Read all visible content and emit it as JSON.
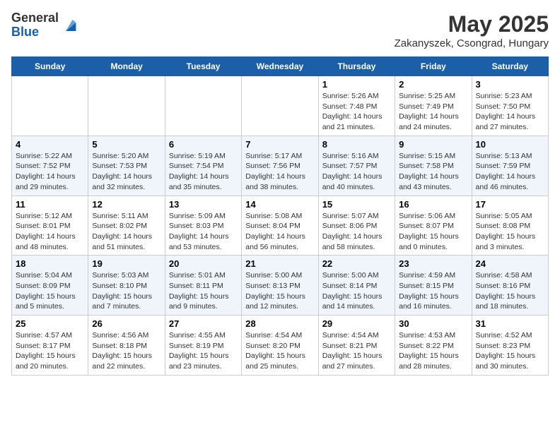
{
  "header": {
    "logo_line1": "General",
    "logo_line2": "Blue",
    "title": "May 2025",
    "subtitle": "Zakanyszek, Csongrad, Hungary"
  },
  "days_of_week": [
    "Sunday",
    "Monday",
    "Tuesday",
    "Wednesday",
    "Thursday",
    "Friday",
    "Saturday"
  ],
  "weeks": [
    [
      {
        "day": "",
        "info": ""
      },
      {
        "day": "",
        "info": ""
      },
      {
        "day": "",
        "info": ""
      },
      {
        "day": "",
        "info": ""
      },
      {
        "day": "1",
        "info": "Sunrise: 5:26 AM\nSunset: 7:48 PM\nDaylight: 14 hours\nand 21 minutes."
      },
      {
        "day": "2",
        "info": "Sunrise: 5:25 AM\nSunset: 7:49 PM\nDaylight: 14 hours\nand 24 minutes."
      },
      {
        "day": "3",
        "info": "Sunrise: 5:23 AM\nSunset: 7:50 PM\nDaylight: 14 hours\nand 27 minutes."
      }
    ],
    [
      {
        "day": "4",
        "info": "Sunrise: 5:22 AM\nSunset: 7:52 PM\nDaylight: 14 hours\nand 29 minutes."
      },
      {
        "day": "5",
        "info": "Sunrise: 5:20 AM\nSunset: 7:53 PM\nDaylight: 14 hours\nand 32 minutes."
      },
      {
        "day": "6",
        "info": "Sunrise: 5:19 AM\nSunset: 7:54 PM\nDaylight: 14 hours\nand 35 minutes."
      },
      {
        "day": "7",
        "info": "Sunrise: 5:17 AM\nSunset: 7:56 PM\nDaylight: 14 hours\nand 38 minutes."
      },
      {
        "day": "8",
        "info": "Sunrise: 5:16 AM\nSunset: 7:57 PM\nDaylight: 14 hours\nand 40 minutes."
      },
      {
        "day": "9",
        "info": "Sunrise: 5:15 AM\nSunset: 7:58 PM\nDaylight: 14 hours\nand 43 minutes."
      },
      {
        "day": "10",
        "info": "Sunrise: 5:13 AM\nSunset: 7:59 PM\nDaylight: 14 hours\nand 46 minutes."
      }
    ],
    [
      {
        "day": "11",
        "info": "Sunrise: 5:12 AM\nSunset: 8:01 PM\nDaylight: 14 hours\nand 48 minutes."
      },
      {
        "day": "12",
        "info": "Sunrise: 5:11 AM\nSunset: 8:02 PM\nDaylight: 14 hours\nand 51 minutes."
      },
      {
        "day": "13",
        "info": "Sunrise: 5:09 AM\nSunset: 8:03 PM\nDaylight: 14 hours\nand 53 minutes."
      },
      {
        "day": "14",
        "info": "Sunrise: 5:08 AM\nSunset: 8:04 PM\nDaylight: 14 hours\nand 56 minutes."
      },
      {
        "day": "15",
        "info": "Sunrise: 5:07 AM\nSunset: 8:06 PM\nDaylight: 14 hours\nand 58 minutes."
      },
      {
        "day": "16",
        "info": "Sunrise: 5:06 AM\nSunset: 8:07 PM\nDaylight: 15 hours\nand 0 minutes."
      },
      {
        "day": "17",
        "info": "Sunrise: 5:05 AM\nSunset: 8:08 PM\nDaylight: 15 hours\nand 3 minutes."
      }
    ],
    [
      {
        "day": "18",
        "info": "Sunrise: 5:04 AM\nSunset: 8:09 PM\nDaylight: 15 hours\nand 5 minutes."
      },
      {
        "day": "19",
        "info": "Sunrise: 5:03 AM\nSunset: 8:10 PM\nDaylight: 15 hours\nand 7 minutes."
      },
      {
        "day": "20",
        "info": "Sunrise: 5:01 AM\nSunset: 8:11 PM\nDaylight: 15 hours\nand 9 minutes."
      },
      {
        "day": "21",
        "info": "Sunrise: 5:00 AM\nSunset: 8:13 PM\nDaylight: 15 hours\nand 12 minutes."
      },
      {
        "day": "22",
        "info": "Sunrise: 5:00 AM\nSunset: 8:14 PM\nDaylight: 15 hours\nand 14 minutes."
      },
      {
        "day": "23",
        "info": "Sunrise: 4:59 AM\nSunset: 8:15 PM\nDaylight: 15 hours\nand 16 minutes."
      },
      {
        "day": "24",
        "info": "Sunrise: 4:58 AM\nSunset: 8:16 PM\nDaylight: 15 hours\nand 18 minutes."
      }
    ],
    [
      {
        "day": "25",
        "info": "Sunrise: 4:57 AM\nSunset: 8:17 PM\nDaylight: 15 hours\nand 20 minutes."
      },
      {
        "day": "26",
        "info": "Sunrise: 4:56 AM\nSunset: 8:18 PM\nDaylight: 15 hours\nand 22 minutes."
      },
      {
        "day": "27",
        "info": "Sunrise: 4:55 AM\nSunset: 8:19 PM\nDaylight: 15 hours\nand 23 minutes."
      },
      {
        "day": "28",
        "info": "Sunrise: 4:54 AM\nSunset: 8:20 PM\nDaylight: 15 hours\nand 25 minutes."
      },
      {
        "day": "29",
        "info": "Sunrise: 4:54 AM\nSunset: 8:21 PM\nDaylight: 15 hours\nand 27 minutes."
      },
      {
        "day": "30",
        "info": "Sunrise: 4:53 AM\nSunset: 8:22 PM\nDaylight: 15 hours\nand 28 minutes."
      },
      {
        "day": "31",
        "info": "Sunrise: 4:52 AM\nSunset: 8:23 PM\nDaylight: 15 hours\nand 30 minutes."
      }
    ]
  ]
}
